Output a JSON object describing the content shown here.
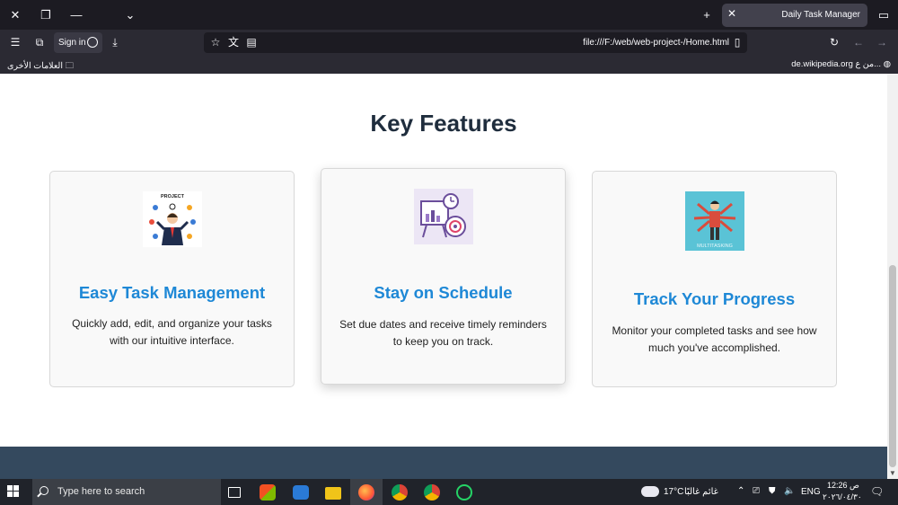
{
  "browser": {
    "tab_title": "Daily Task Manager",
    "signin_label": "Sign in",
    "url": "file:///F:/web/web-project-/Home.html",
    "bookmarks_folder": "العلامات الأخرى",
    "bookmark_item": "de.wikipedia.org من ع..."
  },
  "page": {
    "section_title": "Key Features",
    "cards": [
      {
        "title": "Easy Task Management",
        "description": "Quickly add, edit, and organize your tasks with our intuitive interface.",
        "image_label": "PROJECT"
      },
      {
        "title": "Stay on Schedule",
        "description": "Set due dates and receive timely reminders to keep you on track."
      },
      {
        "title": "Track Your Progress",
        "description": "Monitor your completed tasks and see how much you've accomplished.",
        "image_label": "MULTITASKING"
      }
    ]
  },
  "taskbar": {
    "search_placeholder": "Type here to search",
    "weather_temp": "17°C",
    "weather_desc": "غائم غالبًا",
    "language": "ENG",
    "time": "12:26 ص",
    "date": "٢٠٢٦/٠٤/٣٠"
  },
  "colors": {
    "accent": "#1e88d6",
    "title": "#1f2d3d",
    "footer": "#34495e"
  }
}
